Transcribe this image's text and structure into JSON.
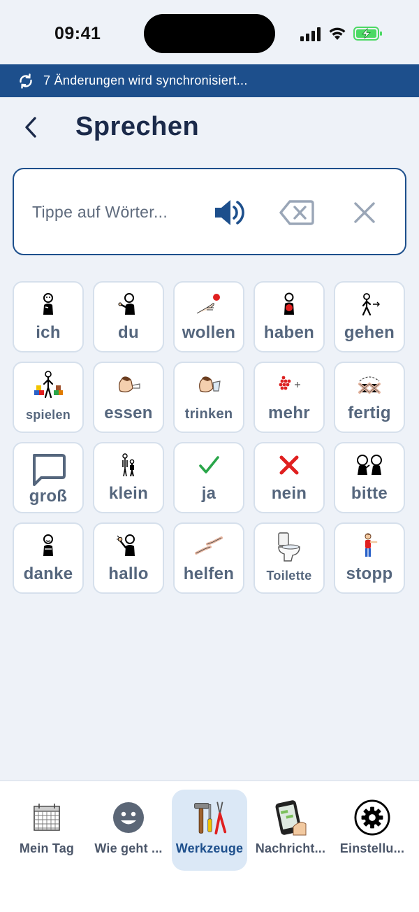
{
  "status_bar": {
    "time": "09:41"
  },
  "sync_banner": {
    "text": "7 Änderungen wird synchronisiert..."
  },
  "header": {
    "title": "Sprechen"
  },
  "speak_box": {
    "placeholder": "Tippe auf Wörter..."
  },
  "words": [
    {
      "label": "ich",
      "icon": "person-pointing-self-icon"
    },
    {
      "label": "du",
      "icon": "person-pointing-you-icon"
    },
    {
      "label": "wollen",
      "icon": "hand-reaching-icon"
    },
    {
      "label": "haben",
      "icon": "person-holding-icon"
    },
    {
      "label": "gehen",
      "icon": "person-walking-icon"
    },
    {
      "label": "spielen",
      "icon": "child-playing-icon"
    },
    {
      "label": "essen",
      "icon": "person-eating-icon"
    },
    {
      "label": "trinken",
      "icon": "person-drinking-icon"
    },
    {
      "label": "mehr",
      "icon": "more-icon"
    },
    {
      "label": "fertig",
      "icon": "finished-icon"
    },
    {
      "label": "groß",
      "icon": "speech-bubble-icon"
    },
    {
      "label": "klein",
      "icon": "big-small-icon"
    },
    {
      "label": "ja",
      "icon": "check-icon"
    },
    {
      "label": "nein",
      "icon": "cross-icon"
    },
    {
      "label": "bitte",
      "icon": "please-icon"
    },
    {
      "label": "danke",
      "icon": "thank-you-icon"
    },
    {
      "label": "hallo",
      "icon": "waving-icon"
    },
    {
      "label": "helfen",
      "icon": "helping-hands-icon"
    },
    {
      "label": "Toilette",
      "icon": "toilet-icon"
    },
    {
      "label": "stopp",
      "icon": "stop-person-icon"
    }
  ],
  "bottom_nav": [
    {
      "label": "Mein Tag",
      "icon": "calendar-icon",
      "active": false
    },
    {
      "label": "Wie geht ...",
      "icon": "smiley-icon",
      "active": false
    },
    {
      "label": "Werkzeuge",
      "icon": "tools-icon",
      "active": true
    },
    {
      "label": "Nachricht...",
      "icon": "phone-message-icon",
      "active": false
    },
    {
      "label": "Einstellu...",
      "icon": "settings-gear-icon",
      "active": false
    }
  ],
  "colors": {
    "accent": "#1d4f8c",
    "background": "#eef2f8",
    "tile_border": "#d6e0ec",
    "word_text": "#55667d",
    "title_text": "#1b2a4a",
    "battery": "#4cd964"
  }
}
